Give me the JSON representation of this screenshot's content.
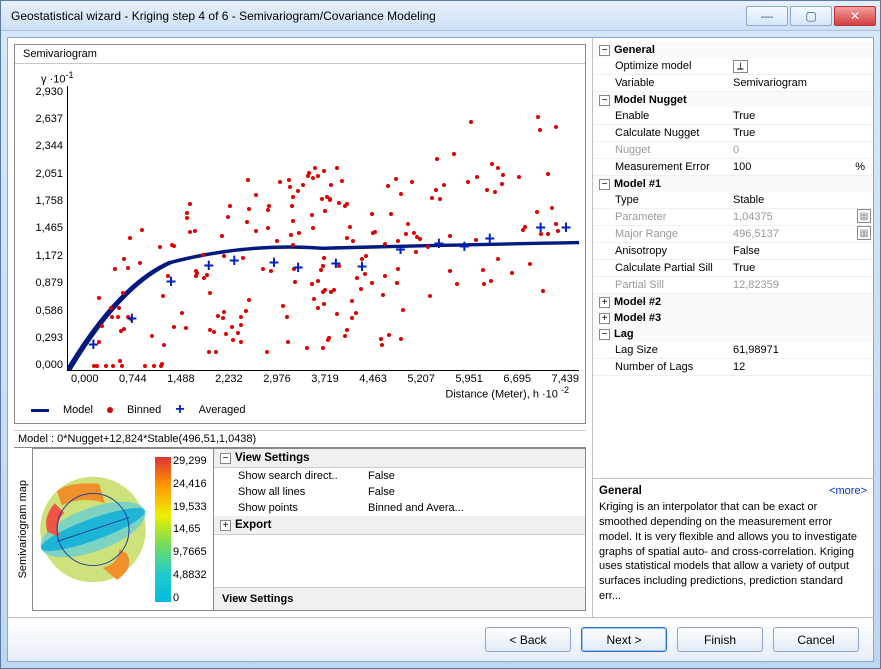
{
  "window": {
    "title": "Geostatistical wizard - Kriging step 4 of 6 - Semivariogram/Covariance Modeling"
  },
  "chart": {
    "title": "Semivariogram",
    "y_unit_prefix": "γ",
    "y_exp": "·10",
    "y_exp_sup": "-1",
    "x_label": "Distance (Meter), h",
    "x_exp": "·10",
    "x_exp_sup": "-2",
    "model_text": "Model : 0*Nugget+12,824*Stable(496,51,1,0438)"
  },
  "chart_data": {
    "type": "scatter",
    "title": "Semivariogram",
    "xlabel": "Distance (Meter), h ·10^-2",
    "ylabel": "γ ·10^-1",
    "xlim": [
      0,
      7.439
    ],
    "ylim": [
      0,
      2.93
    ],
    "x_ticks": [
      "0,000",
      "0,744",
      "1,488",
      "2,232",
      "2,976",
      "3,719",
      "4,463",
      "5,207",
      "5,951",
      "6,695",
      "7,439"
    ],
    "y_ticks": [
      "2,930",
      "2,637",
      "2,344",
      "2,051",
      "1,758",
      "1,465",
      "1,172",
      "0,879",
      "0,586",
      "0,293",
      "0,000"
    ],
    "series": [
      {
        "name": "Model",
        "type": "line",
        "points": [
          [
            0,
            0
          ],
          [
            0.7,
            0.5
          ],
          [
            1.5,
            0.88
          ],
          [
            2.3,
            1.06
          ],
          [
            3.0,
            1.14
          ],
          [
            3.7,
            1.2
          ],
          [
            4.5,
            1.24
          ],
          [
            5.2,
            1.26
          ],
          [
            6.0,
            1.27
          ],
          [
            6.7,
            1.28
          ],
          [
            7.4,
            1.28
          ]
        ]
      },
      {
        "name": "Averaged",
        "type": "points",
        "points": [
          [
            0.37,
            0.26
          ],
          [
            0.93,
            0.53
          ],
          [
            1.5,
            0.91
          ],
          [
            2.05,
            1.07
          ],
          [
            2.42,
            1.13
          ],
          [
            3.0,
            1.1
          ],
          [
            3.35,
            1.05
          ],
          [
            3.9,
            1.09
          ],
          [
            4.28,
            1.06
          ],
          [
            4.84,
            1.24
          ],
          [
            5.4,
            1.3
          ],
          [
            5.77,
            1.27
          ],
          [
            6.14,
            1.35
          ],
          [
            6.88,
            1.47
          ],
          [
            7.25,
            1.46
          ]
        ]
      }
    ],
    "legend": {
      "Model": "line",
      "Binned": "red-dot",
      "Averaged": "blue-plus"
    }
  },
  "legend": {
    "model": "Model",
    "binned": "Binned",
    "averaged": "Averaged"
  },
  "semimap": {
    "label": "Semivariogram map",
    "ticks": [
      "29,299",
      "24,416",
      "19,533",
      "14,65",
      "9,7665",
      "4,8832",
      "0"
    ]
  },
  "view_settings": {
    "header": "View Settings",
    "rows": [
      {
        "k": "Show search direct..",
        "v": "False"
      },
      {
        "k": "Show all lines",
        "v": "False"
      },
      {
        "k": "Show points",
        "v": "Binned and Avera..."
      }
    ],
    "export_header": "Export",
    "footer": "View Settings"
  },
  "props": {
    "general_hdr": "General",
    "general": [
      {
        "k": "Optimize model",
        "v": "",
        "icon": true,
        "interactable": true
      },
      {
        "k": "Variable",
        "v": "Semivariogram",
        "interactable": true
      }
    ],
    "nugget_hdr": "Model Nugget",
    "nugget": [
      {
        "k": "Enable",
        "v": "True",
        "interactable": true
      },
      {
        "k": "Calculate Nugget",
        "v": "True",
        "interactable": true
      },
      {
        "k": "Nugget",
        "v": "0",
        "disabled": true
      },
      {
        "k": "Measurement Error",
        "v": "100",
        "suffix": "%",
        "interactable": true
      }
    ],
    "model1_hdr": "Model #1",
    "model1": [
      {
        "k": "Type",
        "v": "Stable",
        "interactable": true
      },
      {
        "k": "Parameter",
        "v": "1,04375",
        "disabled": true,
        "icon": true
      },
      {
        "k": "Major Range",
        "v": "496,5137",
        "disabled": true,
        "icon": true
      },
      {
        "k": "Anisotropy",
        "v": "False",
        "interactable": true
      },
      {
        "k": "Calculate Partial Sill",
        "v": "True",
        "interactable": true
      },
      {
        "k": "Partial Sill",
        "v": "12,82359",
        "disabled": true
      }
    ],
    "model2_hdr": "Model #2",
    "model3_hdr": "Model #3",
    "lag_hdr": "Lag",
    "lag": [
      {
        "k": "Lag Size",
        "v": "61,98971",
        "interactable": true
      },
      {
        "k": "Number of Lags",
        "v": "12",
        "interactable": true
      }
    ]
  },
  "desc": {
    "title": "General",
    "more": "<more>",
    "body": "Kriging is an interpolator that can be exact or smoothed depending on the measurement error model. It is very flexible and allows you to investigate graphs of spatial auto- and cross-correlation. Kriging uses statistical models that allow a variety of output surfaces including predictions, prediction standard err..."
  },
  "buttons": {
    "back": "< Back",
    "next": "Next >",
    "finish": "Finish",
    "cancel": "Cancel"
  }
}
